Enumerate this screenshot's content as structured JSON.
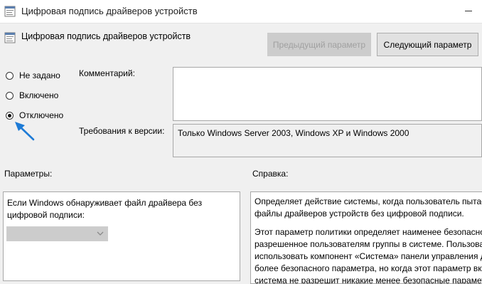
{
  "window": {
    "title": "Цифровая подпись драйверов устройств"
  },
  "header": {
    "policy_name": "Цифровая подпись драйверов устройств"
  },
  "buttons": {
    "prev_label": "Предыдущий параметр",
    "next_label": "Следующий параметр"
  },
  "state": {
    "options": [
      {
        "label": "Не задано",
        "selected": false
      },
      {
        "label": "Включено",
        "selected": false
      },
      {
        "label": "Отключено",
        "selected": true
      }
    ]
  },
  "comment": {
    "label": "Комментарий:",
    "value": ""
  },
  "supported": {
    "label": "Требования к версии:",
    "value": "Только Windows Server 2003, Windows XP и Windows 2000"
  },
  "options_pane": {
    "header": "Параметры:",
    "description_lines": [
      "Если Windows обнаруживает файл драйвера без",
      "цифровой подписи:"
    ],
    "dropdown_value": ""
  },
  "help_pane": {
    "header": "Справка:",
    "lines": [
      "Определяет действие системы, когда пользователь пытае",
      "файлы драйверов устройств без цифровой подписи.",
      "",
      "Этот параметр политики определяет наименее безопасно",
      "разрешенное пользователям группы в системе. Пользова",
      "использовать компонент «Система» панели управления д",
      "более безопасного параметра, но когда этот параметр вк",
      "система не разрешит никакие менее безопасные парамет"
    ]
  },
  "colors": {
    "annotation_arrow": "#1e7bd6",
    "disabled_button": "#cccccc"
  },
  "icons": {
    "window": "policy-icon",
    "arrow": "annotation-arrow"
  }
}
